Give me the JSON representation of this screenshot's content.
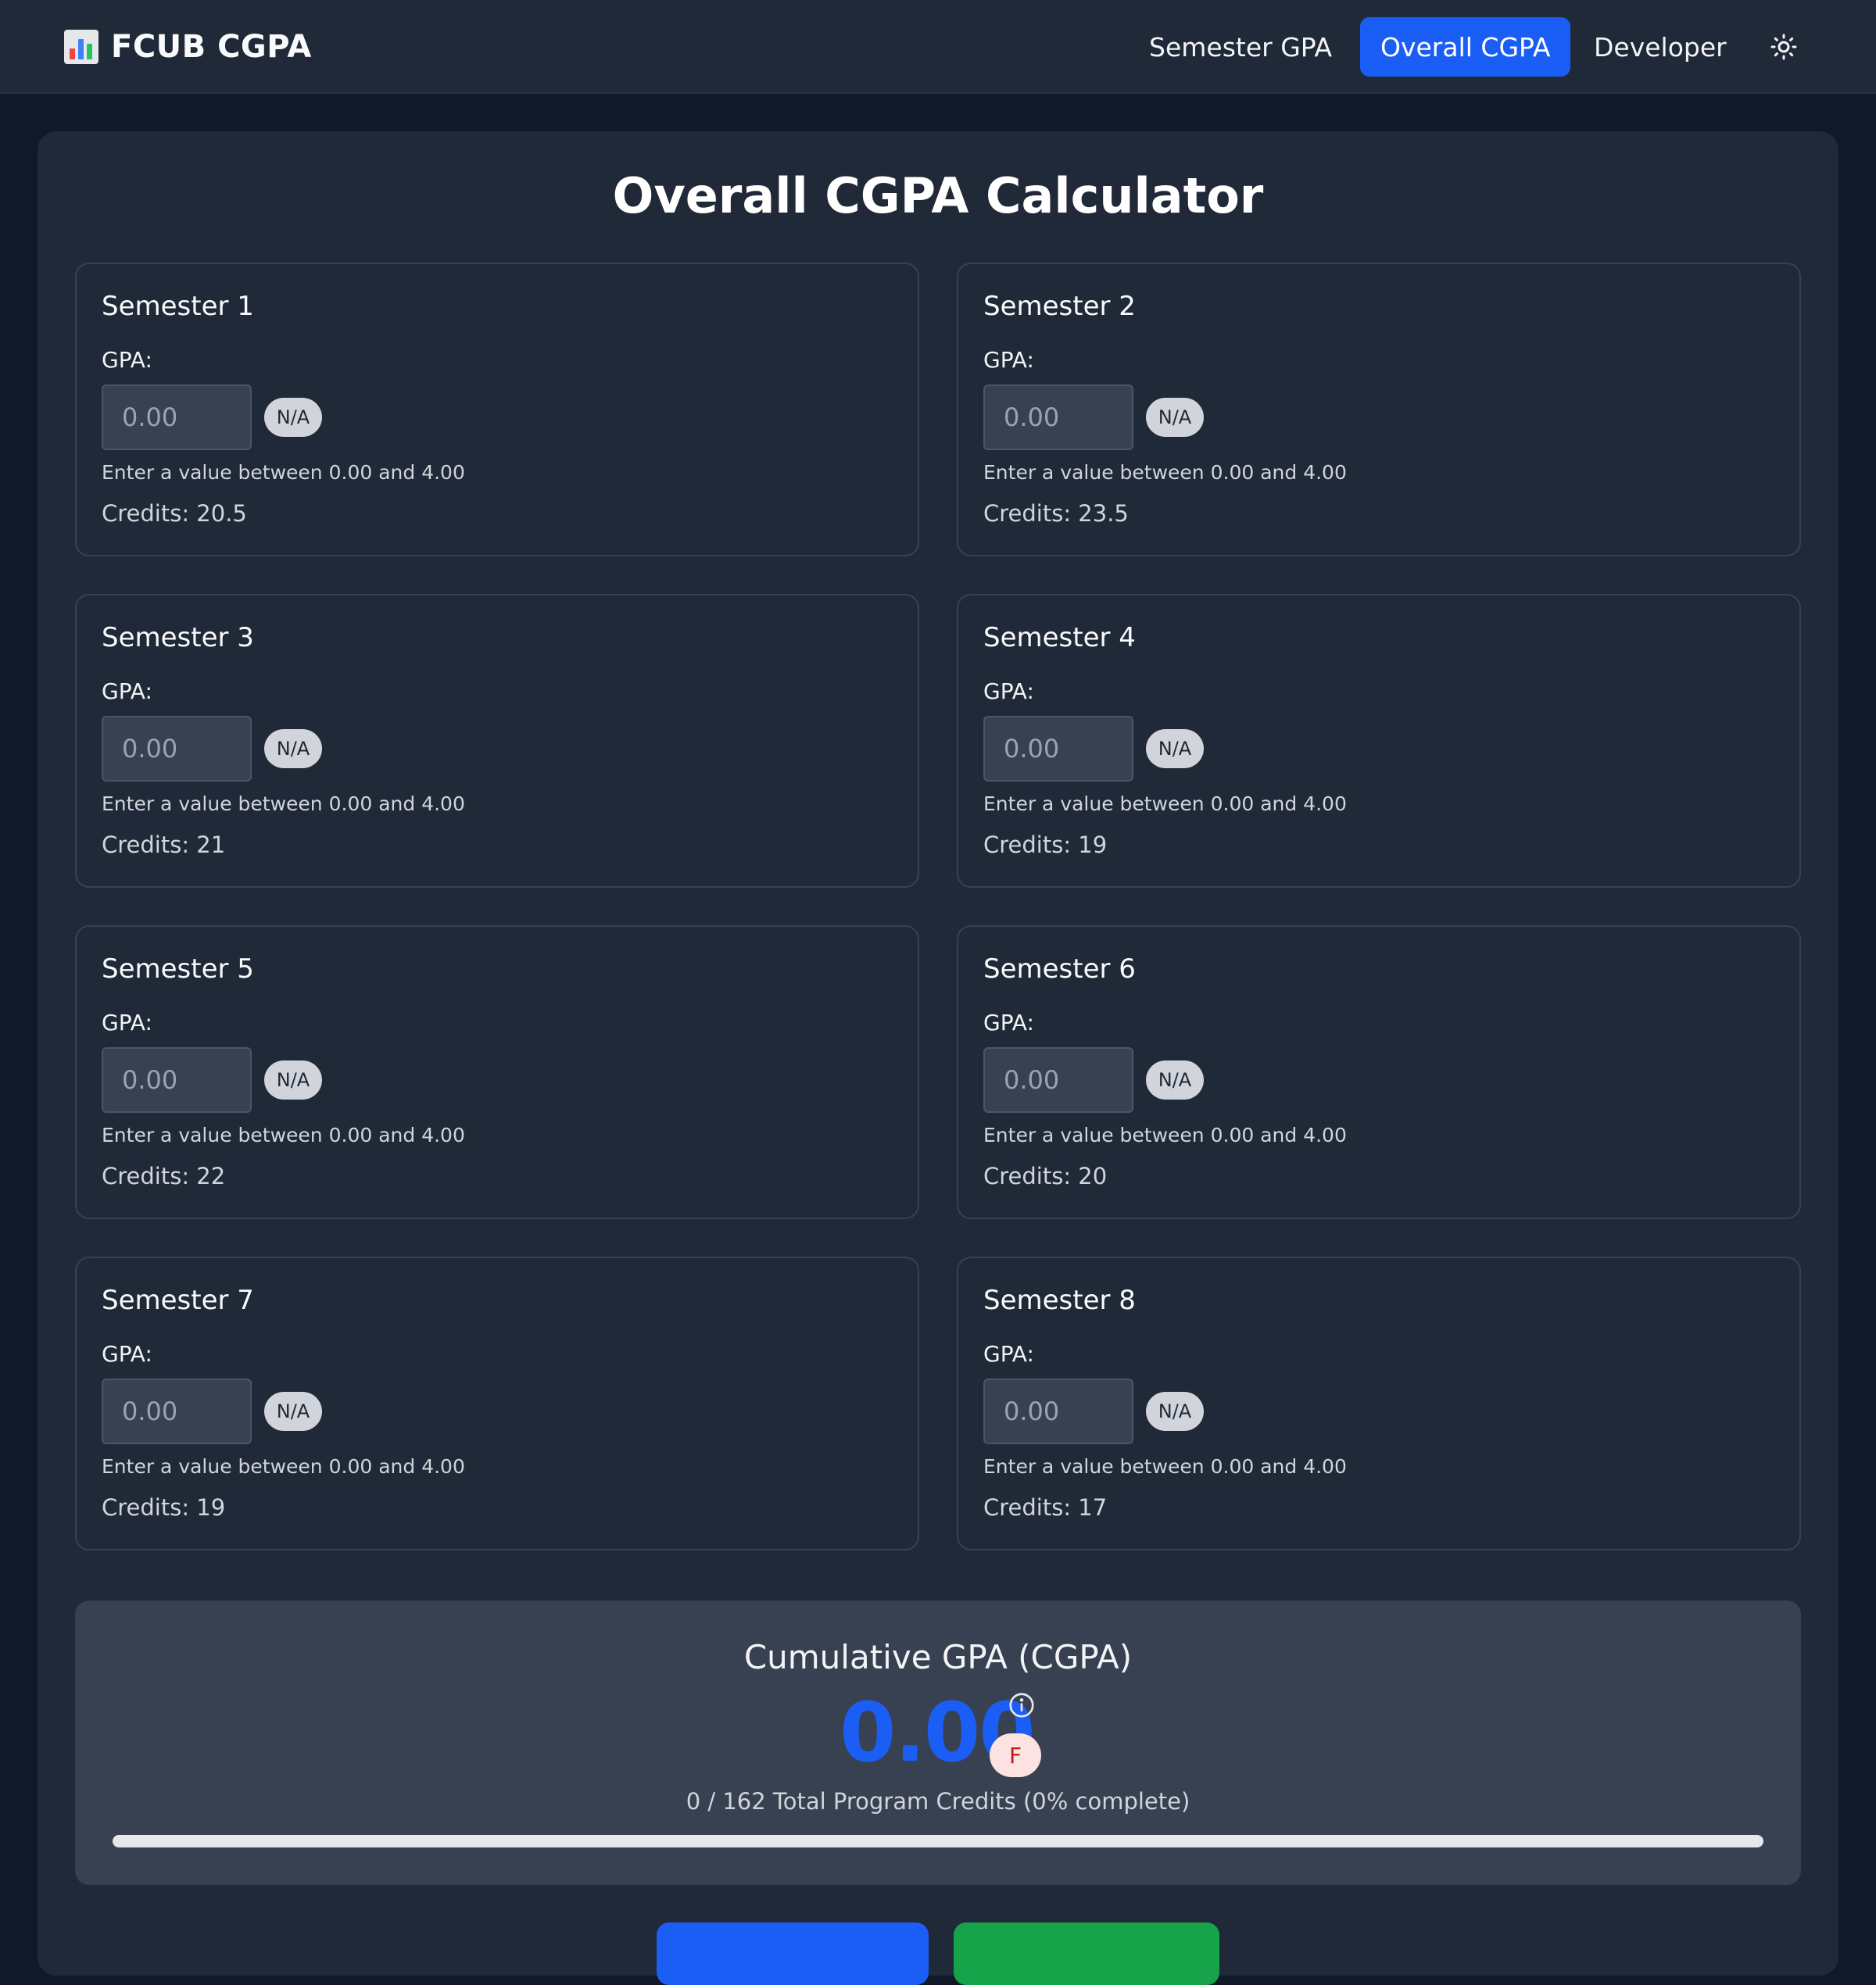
{
  "app": {
    "brand": "FCUB CGPA"
  },
  "nav": {
    "items": [
      {
        "label": "Semester GPA",
        "active": false
      },
      {
        "label": "Overall CGPA",
        "active": true
      },
      {
        "label": "Developer",
        "active": false
      }
    ],
    "theme_icon": "sun-icon"
  },
  "page": {
    "title": "Overall CGPA Calculator"
  },
  "semesters": [
    {
      "title": "Semester 1",
      "gpa_label": "GPA:",
      "placeholder": "0.00",
      "value": "",
      "badge": "N/A",
      "hint": "Enter a value between 0.00 and 4.00",
      "credits": "Credits: 20.5"
    },
    {
      "title": "Semester 2",
      "gpa_label": "GPA:",
      "placeholder": "0.00",
      "value": "",
      "badge": "N/A",
      "hint": "Enter a value between 0.00 and 4.00",
      "credits": "Credits: 23.5"
    },
    {
      "title": "Semester 3",
      "gpa_label": "GPA:",
      "placeholder": "0.00",
      "value": "",
      "badge": "N/A",
      "hint": "Enter a value between 0.00 and 4.00",
      "credits": "Credits: 21"
    },
    {
      "title": "Semester 4",
      "gpa_label": "GPA:",
      "placeholder": "0.00",
      "value": "",
      "badge": "N/A",
      "hint": "Enter a value between 0.00 and 4.00",
      "credits": "Credits: 19"
    },
    {
      "title": "Semester 5",
      "gpa_label": "GPA:",
      "placeholder": "0.00",
      "value": "",
      "badge": "N/A",
      "hint": "Enter a value between 0.00 and 4.00",
      "credits": "Credits: 22"
    },
    {
      "title": "Semester 6",
      "gpa_label": "GPA:",
      "placeholder": "0.00",
      "value": "",
      "badge": "N/A",
      "hint": "Enter a value between 0.00 and 4.00",
      "credits": "Credits: 20"
    },
    {
      "title": "Semester 7",
      "gpa_label": "GPA:",
      "placeholder": "0.00",
      "value": "",
      "badge": "N/A",
      "hint": "Enter a value between 0.00 and 4.00",
      "credits": "Credits: 19"
    },
    {
      "title": "Semester 8",
      "gpa_label": "GPA:",
      "placeholder": "0.00",
      "value": "",
      "badge": "N/A",
      "hint": "Enter a value between 0.00 and 4.00",
      "credits": "Credits: 17"
    }
  ],
  "result": {
    "title": "Cumulative GPA (CGPA)",
    "cgpa": "0.00",
    "grade": "F",
    "info_icon": "info-icon",
    "credits_summary": "0 / 162 Total Program Credits (0% complete)",
    "progress_fraction": 0
  },
  "colors": {
    "accent": "#1b5ef5",
    "success": "#16a34a",
    "background": "#111827",
    "surface": "#1f2937"
  }
}
